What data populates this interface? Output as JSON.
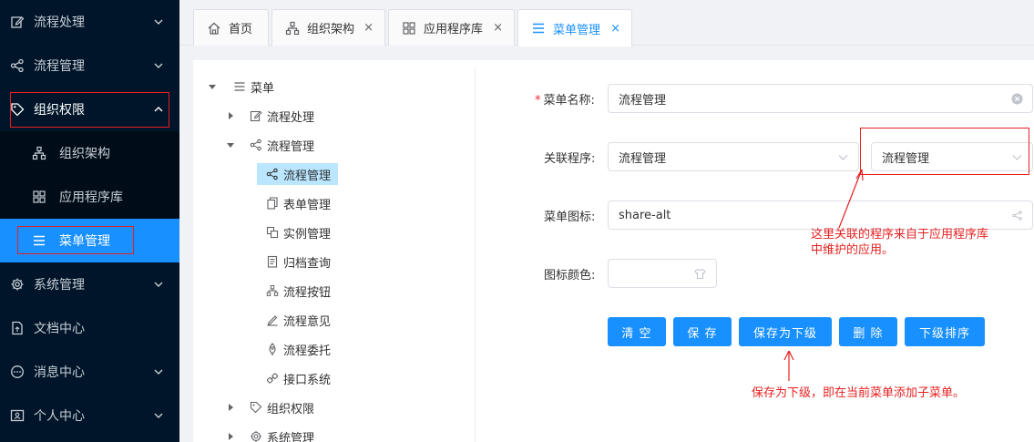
{
  "sidebar": {
    "items": [
      {
        "label": "流程处理",
        "icon": "edit-icon"
      },
      {
        "label": "流程管理",
        "icon": "share-icon"
      },
      {
        "label": "组织权限",
        "icon": "tag-icon"
      },
      {
        "label": "组织架构",
        "icon": "org-icon"
      },
      {
        "label": "应用程序库",
        "icon": "grid-icon"
      },
      {
        "label": "菜单管理",
        "icon": "menu-icon"
      },
      {
        "label": "系统管理",
        "icon": "gear-icon"
      },
      {
        "label": "文档中心",
        "icon": "file-icon"
      },
      {
        "label": "消息中心",
        "icon": "message-icon"
      },
      {
        "label": "个人中心",
        "icon": "user-card-icon"
      }
    ]
  },
  "tabs": [
    {
      "label": "首页",
      "icon": "home-icon"
    },
    {
      "label": "组织架构",
      "icon": "org-icon",
      "close": "×"
    },
    {
      "label": "应用程序库",
      "icon": "grid-icon",
      "close": "×"
    },
    {
      "label": "菜单管理",
      "icon": "menu-icon",
      "close": "×"
    }
  ],
  "tree": {
    "root": "菜单",
    "nodes": [
      {
        "label": "流程处理"
      },
      {
        "label": "流程管理"
      },
      {
        "label": "流程管理"
      },
      {
        "label": "表单管理"
      },
      {
        "label": "实例管理"
      },
      {
        "label": "归档查询"
      },
      {
        "label": "流程按钮"
      },
      {
        "label": "流程意见"
      },
      {
        "label": "流程委托"
      },
      {
        "label": "接口系统"
      },
      {
        "label": "组织权限"
      },
      {
        "label": "系统管理"
      }
    ]
  },
  "form": {
    "required_mark": "*",
    "name_label": "菜单名称:",
    "name_value": "流程管理",
    "program_label": "关联程序:",
    "program_value_1": "流程管理",
    "program_value_2": "流程管理",
    "icon_label": "菜单图标:",
    "icon_value": "share-alt",
    "color_label": "图标颜色:"
  },
  "buttons": {
    "clear": "清 空",
    "save": "保 存",
    "save_child": "保存为下级",
    "delete": "删 除",
    "sort_children": "下级排序"
  },
  "annotations": {
    "program_note_line1": "这里关联的程序来自于应用程序库",
    "program_note_line2": "中维护的应用。",
    "save_child_note": "保存为下级，即在当前菜单添加子菜单。"
  },
  "colors": {
    "sidebar_bg": "#001529",
    "accent": "#1890ff",
    "annotation": "#e62020"
  }
}
